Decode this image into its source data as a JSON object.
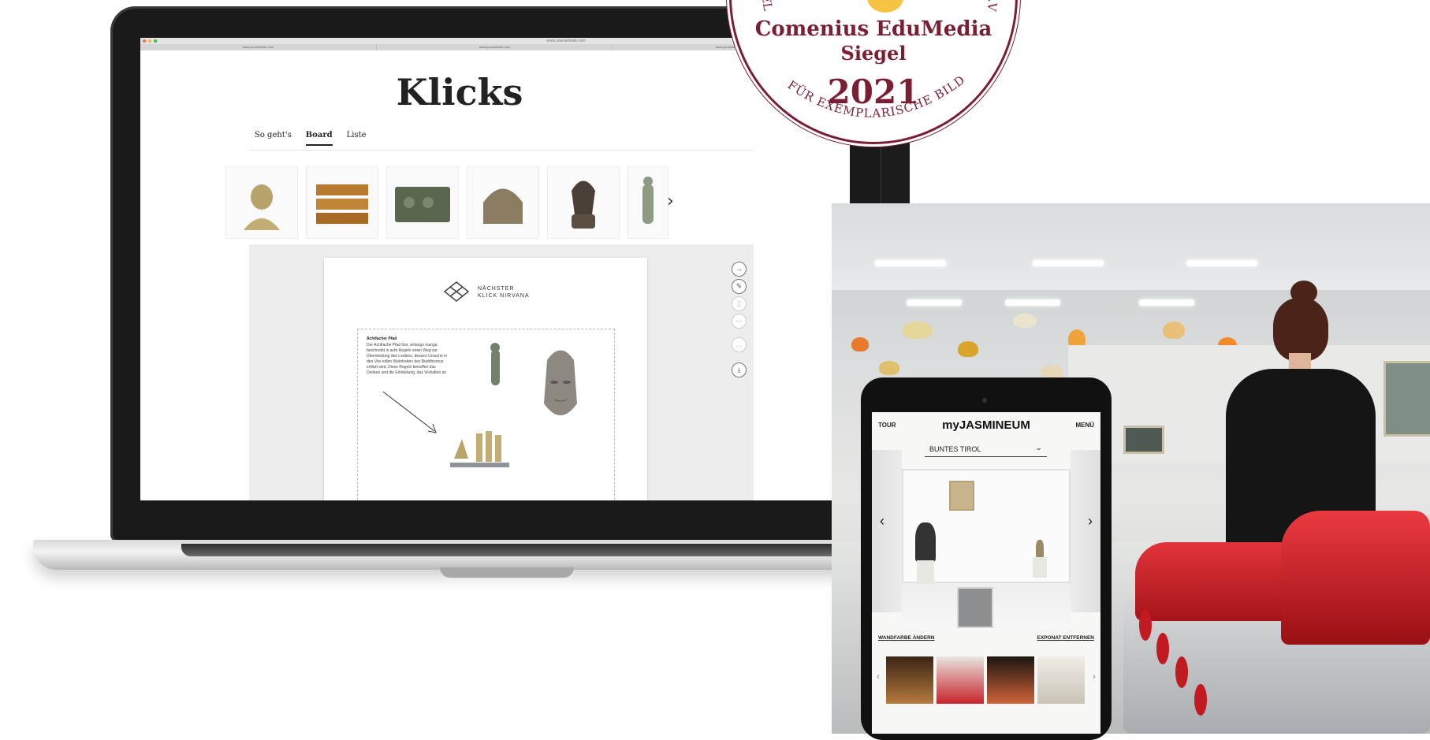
{
  "laptop": {
    "browser": {
      "url": "www.yourwebsite.com",
      "tabs": [
        "www.yourwebsite.com",
        "www.yourwebsite.com",
        "www.yourwebsite.com"
      ]
    },
    "site": {
      "title": "Klicks",
      "tabs": [
        {
          "label": "So geht's",
          "active": false
        },
        {
          "label": "Board",
          "active": true
        },
        {
          "label": "Liste",
          "active": false
        }
      ],
      "strip_prev": "‹",
      "strip_next": "›",
      "board": {
        "logo_line1": "NÄCHSTER",
        "logo_line2": "KLICK NIRVANA",
        "note_title": "Achtfacher Pfad",
        "note_text": "Der Achtfache Pfad löst, anfangs manga beschreibt in acht Regeln einen Weg zur Überwindung des Leidens, dessen Ursache in den Vier edlen Wahrheiten des Buddhismus erklärt wird. Diese Regeln betreffen das Denken und die Einstellung, das Verhalten an"
      },
      "tools": [
        "→",
        "✎",
        "▯",
        "—",
        "…",
        "⤓"
      ]
    }
  },
  "seal": {
    "name": "Comenius EduMedia",
    "siegel": "Siegel",
    "year": "2021",
    "ring_left": "GESEL",
    "ring_right": "EN E.V.",
    "ring_bottom": "FÜR EXEMPLARISCHE BILDUNGSMEDIEN"
  },
  "tablet": {
    "tour": "TOUR",
    "logo": "myJASMINEUM",
    "menu": "MENÜ",
    "select_value": "BUNTES TIROL",
    "prev": "‹",
    "next": "›",
    "change_wall": "WANDFARBE ÄNDERN",
    "remove_exhibit": "EXPONAT ENTFERNEN"
  },
  "colors": {
    "seal_accent": "#7a1f33",
    "bench_red": "#d1262c",
    "board_bg": "#ededed"
  }
}
